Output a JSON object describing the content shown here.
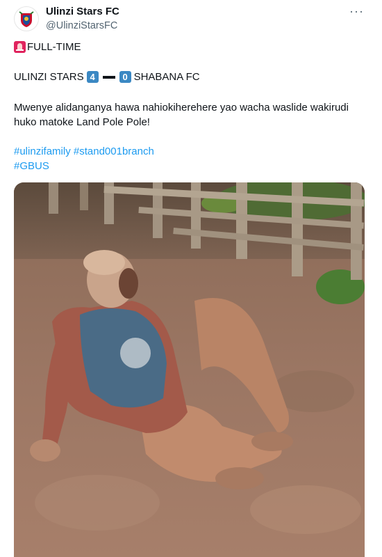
{
  "account": {
    "display_name": "Ulinzi Stars FC",
    "handle": "@UlinziStarsFC",
    "avatar_icon": "club-crest-icon"
  },
  "menu": {
    "more_label": "···",
    "icon": "more-icon"
  },
  "tweet": {
    "status_icon": "siren-icon",
    "status_text": "FULL-TIME",
    "home_team": "ULINZI STARS",
    "home_score": "4",
    "away_score": "0",
    "away_team": "SHABANA FC",
    "message": "Mwenye alidanganya hawa nahiokiherehere yao wacha waslide wakirudi huko matoke Land Pole Pole!",
    "hashtags": [
      "#ulinzifamily",
      "#stand001branch",
      "#GBUS"
    ]
  },
  "colors": {
    "link": "#1d9bf0",
    "score_badge": "#3b88c3",
    "siren": "#e0245e",
    "secondary_text": "#536471"
  }
}
